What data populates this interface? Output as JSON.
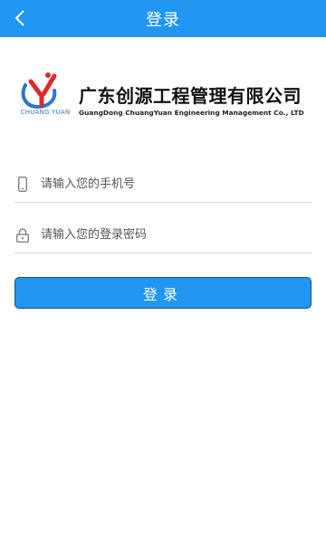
{
  "header": {
    "title": "登录",
    "back_icon": "chevron-left-icon"
  },
  "logo": {
    "mark_letter": "Y",
    "sub_text": "CHUANG YUAN",
    "company_cn": "广东创源工程管理有限公司",
    "company_en": "GuangDong ChuangYuan Engineering Management Co., LTD"
  },
  "form": {
    "phone": {
      "placeholder": "请输入您的手机号",
      "value": "",
      "icon": "phone-icon"
    },
    "password": {
      "placeholder": "请输入您的登录密码",
      "value": "",
      "icon": "lock-icon"
    },
    "login_label": "登录"
  },
  "colors": {
    "primary": "#2196f3",
    "logo_red": "#e0282e",
    "logo_blue": "#2e77c6"
  }
}
